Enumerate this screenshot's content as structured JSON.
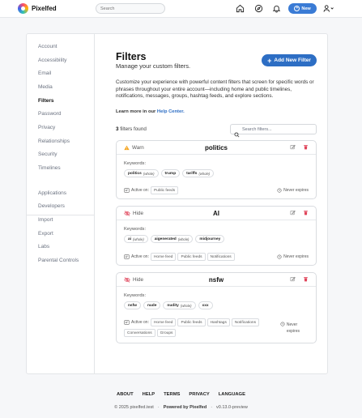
{
  "app": {
    "name": "Pixelfed"
  },
  "nav": {
    "search_placeholder": "Search",
    "new_label": "New"
  },
  "sidebar": {
    "items": [
      {
        "label": "Account"
      },
      {
        "label": "Accessibility"
      },
      {
        "label": "Email"
      },
      {
        "label": "Media"
      },
      {
        "label": "Filters",
        "active": true
      },
      {
        "label": "Password"
      },
      {
        "label": "Privacy"
      },
      {
        "label": "Relationships"
      },
      {
        "label": "Security"
      },
      {
        "label": "Timelines"
      }
    ],
    "secondary_items": [
      {
        "label": "Applications"
      },
      {
        "label": "Developers"
      },
      {
        "label": "Import"
      },
      {
        "label": "Export"
      },
      {
        "label": "Labs"
      },
      {
        "label": "Parental Controls"
      }
    ]
  },
  "main": {
    "title": "Filters",
    "subtitle": "Manage your custom filters.",
    "add_button": "Add New Filter",
    "description": "Customize your experience with powerful content filters that screen for specific words or phrases throughout your entire account—including home and public timelines, notifications, messages, groups, hashtag feeds, and explore sections.",
    "learn_prefix": "Learn more in our",
    "learn_link": "Help Center.",
    "count_number": "3",
    "count_label": "filters found",
    "filter_search_placeholder": "Search filters...",
    "keywords_label": "Keywords:",
    "active_on_label": "Active on:",
    "filters": [
      {
        "action": "Warn",
        "title": "politics",
        "keywords": [
          {
            "word": "politics",
            "mode": "(whole)"
          },
          {
            "word": "trump",
            "mode": ""
          },
          {
            "word": "tariffs",
            "mode": "(whole)"
          }
        ],
        "contexts": [
          "Public feeds"
        ],
        "expires": "Never expires"
      },
      {
        "action": "Hide",
        "title": "AI",
        "keywords": [
          {
            "word": "ai",
            "mode": "(whole)"
          },
          {
            "word": "aigenerated",
            "mode": "(whole)"
          },
          {
            "word": "midjourney",
            "mode": ""
          }
        ],
        "contexts": [
          "Home feed",
          "Public feeds",
          "Notifications"
        ],
        "expires": "Never expires"
      },
      {
        "action": "Hide",
        "title": "nsfw",
        "keywords": [
          {
            "word": "nsfw",
            "mode": ""
          },
          {
            "word": "nude",
            "mode": ""
          },
          {
            "word": "nudity",
            "mode": "(whole)"
          },
          {
            "word": "xxx",
            "mode": ""
          }
        ],
        "contexts": [
          "Home feed",
          "Public feeds",
          "Hashtags",
          "Notifications",
          "Conversations",
          "Groups"
        ],
        "expires_line1": "Never",
        "expires_line2": "expires"
      }
    ]
  },
  "footer": {
    "links": [
      "ABOUT",
      "HELP",
      "TERMS",
      "PRIVACY",
      "LANGUAGE"
    ],
    "copyright": "© 2025 pixelfed.test",
    "dot": "·",
    "powered": "Powered by Pixelfed",
    "version": "v0.13.0-preview"
  },
  "colors": {
    "accent": "#2d6ec4",
    "warn": "#f5a623",
    "hide": "#e0445a",
    "delete": "#e0445a"
  },
  "icons": [
    "home-icon",
    "compass-icon",
    "bell-icon",
    "user-icon",
    "search-icon",
    "warning-icon",
    "eye-slash-icon",
    "edit-icon",
    "trash-icon",
    "filter-context-icon",
    "clock-icon"
  ]
}
